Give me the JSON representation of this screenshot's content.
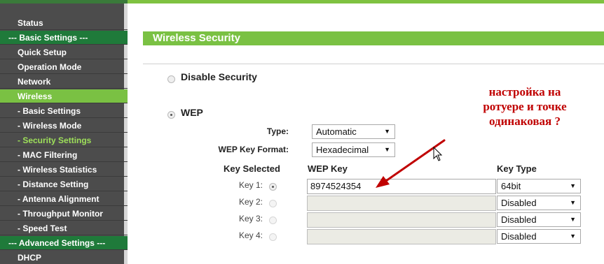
{
  "sidebar": {
    "items": [
      {
        "label": "Status",
        "kind": "top"
      },
      {
        "label": "--- Basic Settings ---",
        "kind": "section"
      },
      {
        "label": "Quick Setup",
        "kind": "top"
      },
      {
        "label": "Operation Mode",
        "kind": "top"
      },
      {
        "label": "Network",
        "kind": "top"
      },
      {
        "label": "Wireless",
        "kind": "active-top"
      },
      {
        "label": "- Basic Settings",
        "kind": "sub"
      },
      {
        "label": "- Wireless Mode",
        "kind": "sub"
      },
      {
        "label": "- Security Settings",
        "kind": "active-sub"
      },
      {
        "label": "- MAC Filtering",
        "kind": "sub"
      },
      {
        "label": "- Wireless Statistics",
        "kind": "sub"
      },
      {
        "label": "- Distance Setting",
        "kind": "sub"
      },
      {
        "label": "- Antenna Alignment",
        "kind": "sub"
      },
      {
        "label": "- Throughput Monitor",
        "kind": "sub"
      },
      {
        "label": "- Speed Test",
        "kind": "sub"
      },
      {
        "label": "--- Advanced Settings ---",
        "kind": "section"
      },
      {
        "label": "DHCP",
        "kind": "top"
      }
    ]
  },
  "page": {
    "title": "Wireless Security",
    "disable_security_label": "Disable Security",
    "wep_label": "WEP",
    "type_label": "Type:",
    "type_value": "Automatic",
    "format_label": "WEP Key Format:",
    "format_value": "Hexadecimal",
    "col_key_selected": "Key Selected",
    "col_wep_key": "WEP Key",
    "col_key_type": "Key Type",
    "keys": [
      {
        "label": "Key 1:",
        "value": "8974524354",
        "type": "64bit",
        "selected": true
      },
      {
        "label": "Key 2:",
        "value": "",
        "type": "Disabled",
        "selected": false
      },
      {
        "label": "Key 3:",
        "value": "",
        "type": "Disabled",
        "selected": false
      },
      {
        "label": "Key 4:",
        "value": "",
        "type": "Disabled",
        "selected": false
      }
    ]
  },
  "annotation": {
    "line1": "настройка на",
    "line2": "ротуере и точке",
    "line3": "одинаковая ?"
  },
  "colors": {
    "accent_green": "#7ac143",
    "section_green": "#1f7a3a",
    "sidebar_bg": "#4c4c4c",
    "annotation_red": "#c00000"
  },
  "icons": {
    "select_arrow": "▼"
  }
}
